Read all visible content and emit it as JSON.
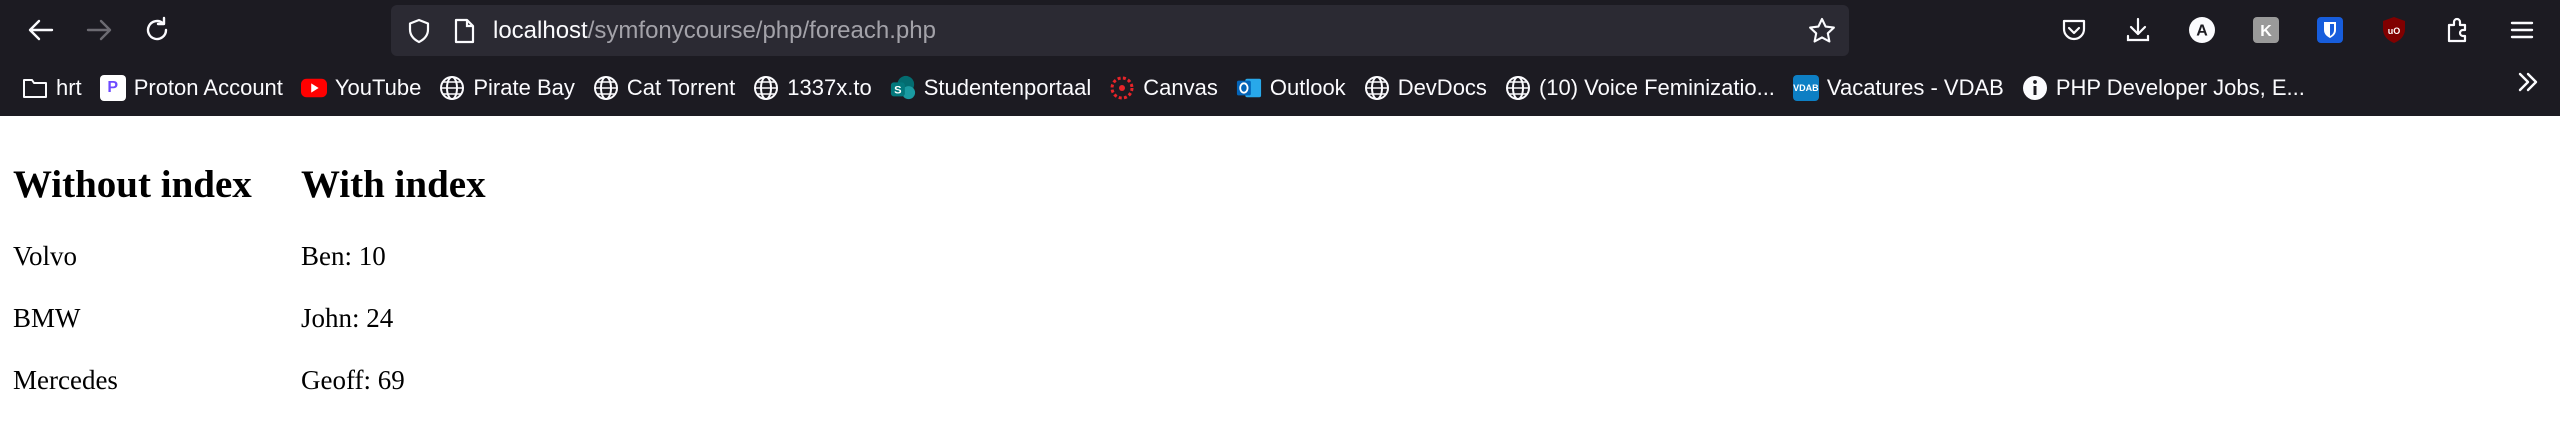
{
  "browser": {
    "url": {
      "host": "localhost",
      "path": "/symfonycourse/php/foreach.php"
    },
    "bookmarks": [
      {
        "label": "hrt",
        "icon": "folder-icon"
      },
      {
        "label": "Proton Account",
        "icon": "proton-icon"
      },
      {
        "label": "YouTube",
        "icon": "youtube-icon"
      },
      {
        "label": "Pirate Bay",
        "icon": "globe-icon"
      },
      {
        "label": "Cat Torrent",
        "icon": "globe-icon"
      },
      {
        "label": "1337x.to",
        "icon": "globe-icon"
      },
      {
        "label": "Studentenportaal",
        "icon": "sharepoint-icon"
      },
      {
        "label": "Canvas",
        "icon": "canvas-icon"
      },
      {
        "label": "Outlook",
        "icon": "outlook-icon"
      },
      {
        "label": "DevDocs",
        "icon": "globe-icon"
      },
      {
        "label": "(10) Voice Feminizatio...",
        "icon": "globe-icon"
      },
      {
        "label": "Vacatures - VDAB",
        "icon": "vdab-icon"
      },
      {
        "label": "PHP Developer Jobs, E...",
        "icon": "info-icon"
      }
    ],
    "toolbar_icons": [
      "pocket-icon",
      "download-icon",
      "account-icon",
      "extension-k-icon",
      "bitwarden-icon",
      "ublock-icon",
      "extensions-icon",
      "menu-icon"
    ],
    "colors": {
      "chrome_bg": "#1c1b22",
      "urlbar_bg": "#2b2a33",
      "text_light": "#fbfbfe"
    }
  },
  "page": {
    "columns": [
      {
        "heading": "Without index",
        "items": [
          "Volvo",
          "BMW",
          "Mercedes"
        ]
      },
      {
        "heading": "With index",
        "items": [
          "Ben: 10",
          "John: 24",
          "Geoff: 69"
        ]
      }
    ]
  }
}
